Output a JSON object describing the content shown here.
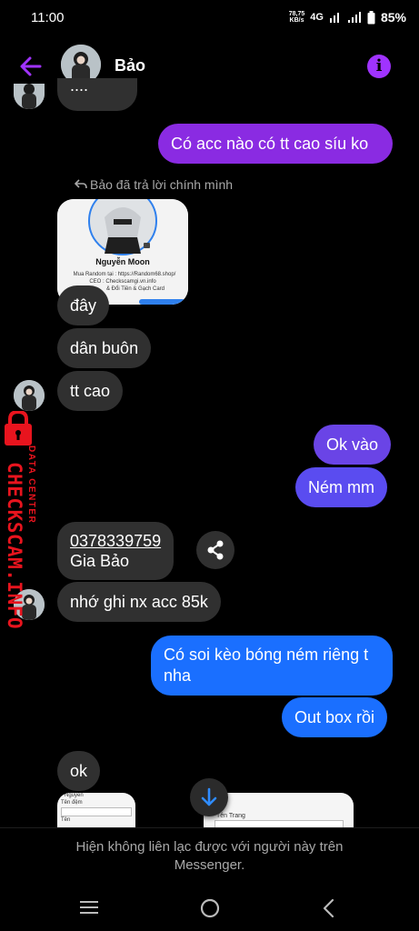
{
  "status_bar": {
    "time": "11:00",
    "speed_value": "78,75",
    "speed_unit": "KB/s",
    "network": "4G",
    "battery": "85%"
  },
  "header": {
    "contact_name": "Bảo",
    "back_icon": "arrow-left-icon",
    "info_icon": "info-icon",
    "accent_color": "#a033ff"
  },
  "messages": {
    "top_partial": "....",
    "m1": "Có acc nào có tt cao síu ko",
    "reply_label": "Bảo đã trả lời chính mình",
    "card": {
      "name": "Nguyễn Moon",
      "line1": "Mua Random tại : https://Random68.shop/",
      "line2": "CEO : Checkscamgi.vn.info",
      "line3": "& Đổi Tiền & Gạch Card"
    },
    "m2": "đây",
    "m3": "dân buôn",
    "m4": "tt cao",
    "m5": "Ok vào",
    "m6": "Ném mm",
    "m7_line1": "0378339759",
    "m7_line2": "Gia Bảo",
    "m8": "nhớ ghi nx acc 85k",
    "m9_line1": "Có soi kèo bóng ném riêng t",
    "m9_line2": "nha",
    "m10": "Out box rồi",
    "m11": "ok",
    "form_preview": {
      "f1": "Nguyễn",
      "f2": "Tên đệm",
      "f3": "Tên",
      "f4": "Tên Trang"
    }
  },
  "watermark": {
    "brand": "CHECKSCAM.INFO",
    "sub": "DATA CENTER"
  },
  "footer": {
    "notice_line1": "Hiện không liên lạc được với người này trên",
    "notice_line2": "Messenger."
  },
  "colors": {
    "out_purple": "#8a2be2",
    "out_blue": "#1a6fff",
    "in_bubble": "#303030",
    "watermark_red": "#e8141e"
  }
}
